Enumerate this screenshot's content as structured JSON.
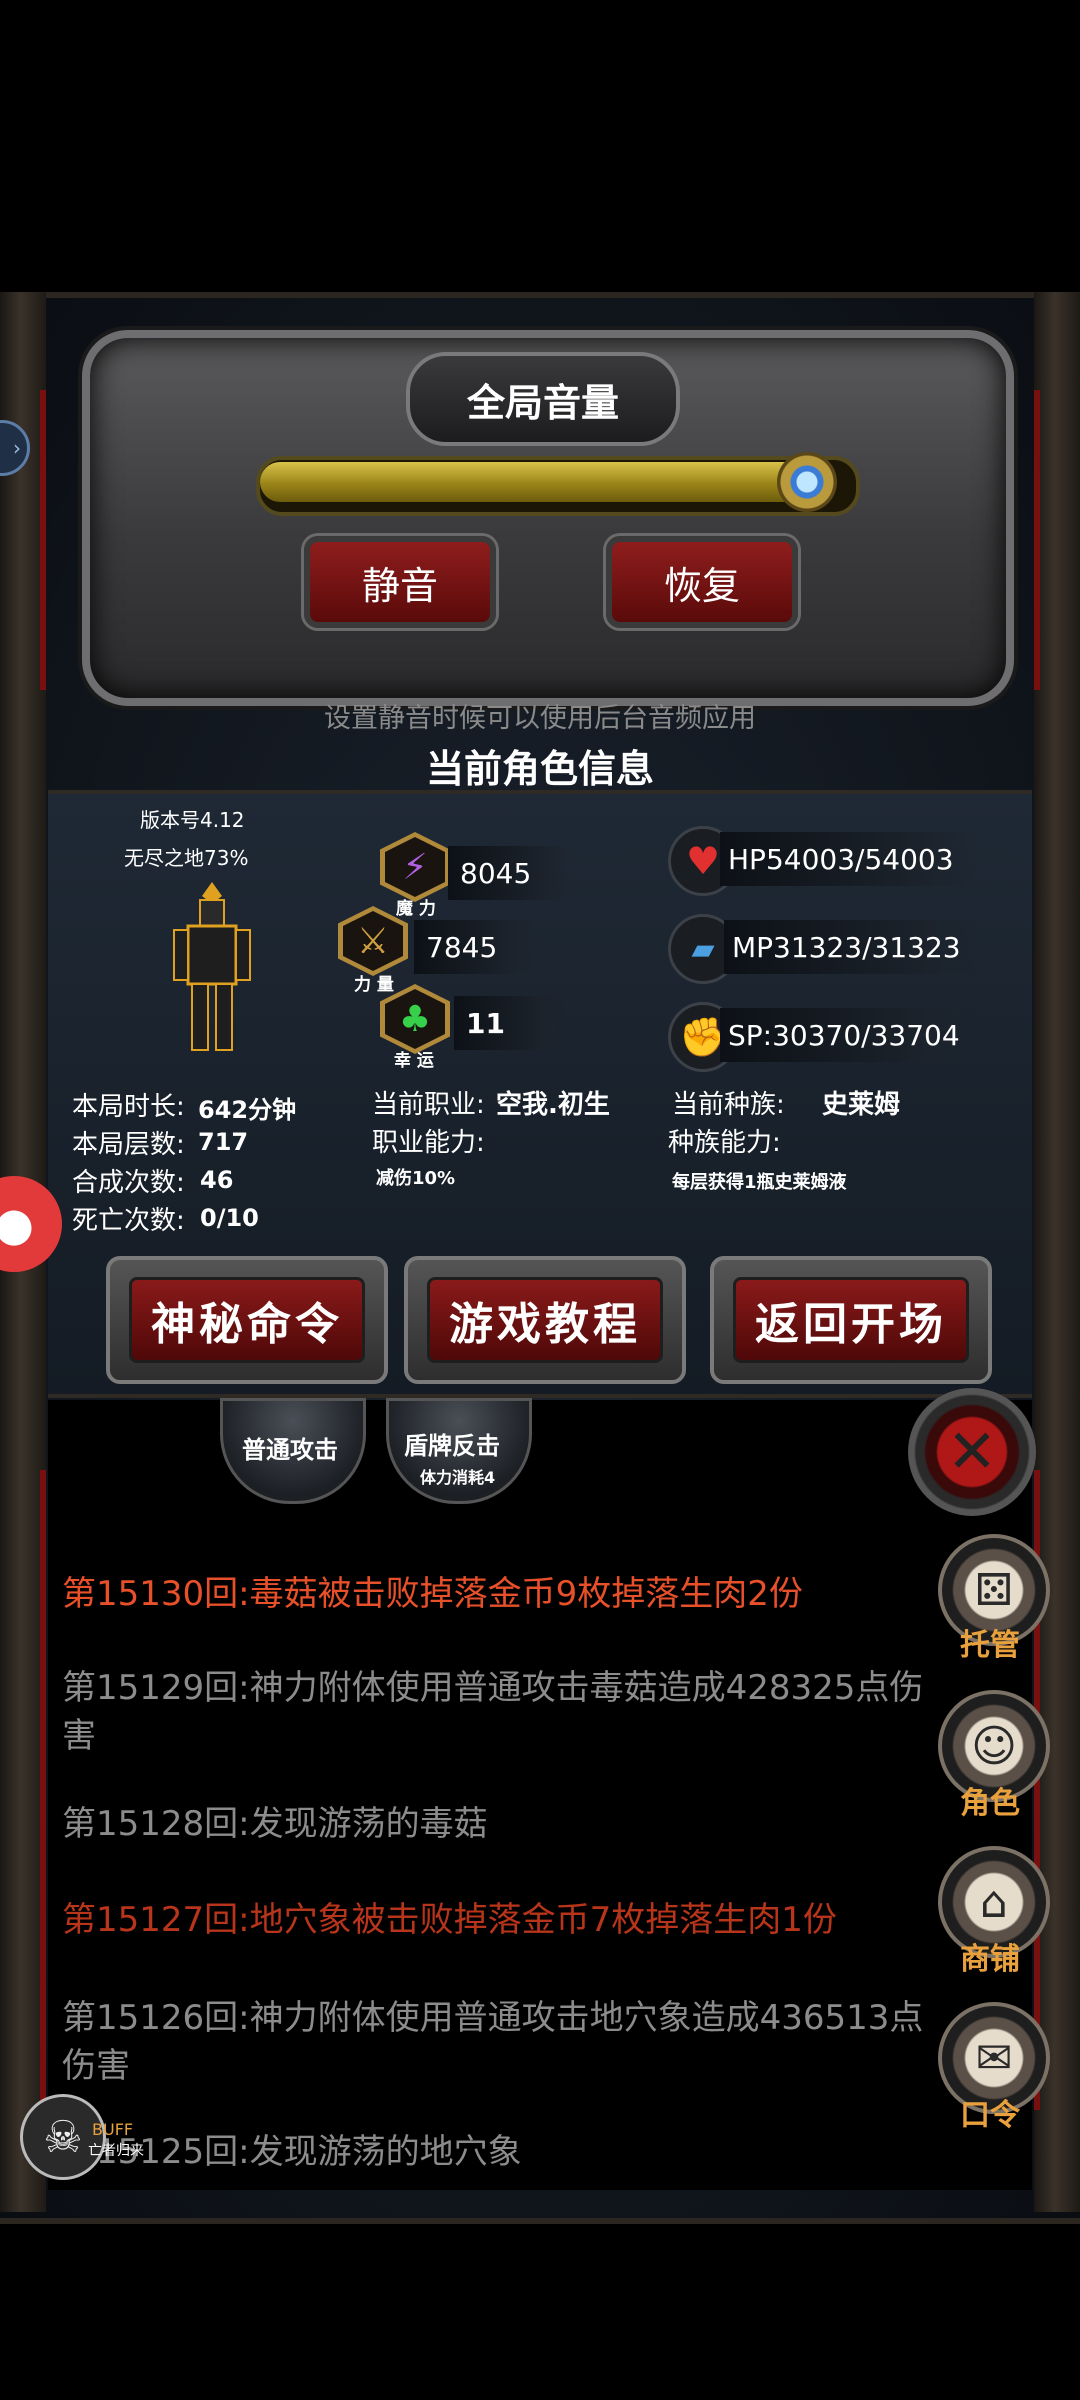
{
  "volume": {
    "title": "全局音量",
    "level": 0.93,
    "mute_label": "静音",
    "restore_label": "恢复",
    "hint": "设置静音时候可以使用后台音频应用"
  },
  "character": {
    "section_title": "当前角色信息",
    "version": "版本号4.12",
    "realm": "无尽之地73%",
    "stats": {
      "magic": {
        "value": "8045",
        "label": "魔 力"
      },
      "strength": {
        "value": "7845",
        "label": "力 量"
      },
      "luck": {
        "value": "11",
        "label": "幸 运"
      }
    },
    "vitals": {
      "hp": "HP54003/54003",
      "mp": "MP31323/31323",
      "sp": "SP:30370/33704"
    },
    "run": {
      "time_label": "本局时长:",
      "time_value": "642分钟",
      "floors_label": "本局层数:",
      "floors_value": "717",
      "merges_label": "合成次数:",
      "merges_value": "46",
      "deaths_label": "死亡次数:",
      "deaths_value": "0/10"
    },
    "job": {
      "label": "当前职业:",
      "value": "空我.初生",
      "ability_label": "职业能力:",
      "ability_value": "减伤10%"
    },
    "race": {
      "label": "当前种族:",
      "value": "史莱姆",
      "ability_label": "种族能力:",
      "ability_value": "每层获得1瓶史莱姆液"
    },
    "buttons": {
      "secret": "神秘命令",
      "tutorial": "游戏教程",
      "back": "返回开场"
    }
  },
  "skills": {
    "normal_attack": "普通攻击",
    "shield_counter": "盾牌反击",
    "shield_cost": "体力消耗4"
  },
  "side_menu": {
    "auto": "托管",
    "role": "角色",
    "shop": "商铺",
    "command": "口令"
  },
  "buff": {
    "tag": "BUFF",
    "name": "亡者归来"
  },
  "log": [
    {
      "text": "第15130回:毒菇被击败掉落金币9枚掉落生肉2份",
      "color": "#e8502a"
    },
    {
      "text": "第15129回:神力附体使用普通攻击毒菇造成428325点伤害",
      "color": "#8c8c8c"
    },
    {
      "text": "第15128回:发现游荡的毒菇",
      "color": "#8c8c8c"
    },
    {
      "text": "第15127回:地穴象被击败掉落金币7枚掉落生肉1份",
      "color": "#b8341a"
    },
    {
      "text": "第15126回:神力附体使用普通攻击地穴象造成436513点伤害",
      "color": "#8c8c8c"
    },
    {
      "text": "第15125回:发现游荡的地穴象",
      "color": "#8c8c8c"
    }
  ]
}
